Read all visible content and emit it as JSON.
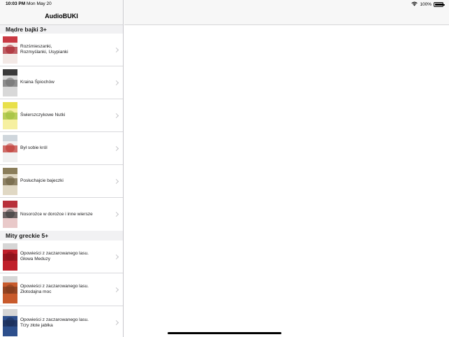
{
  "status_bar": {
    "time": "10:03 PM",
    "date": "Mon May 20",
    "battery": "100%",
    "battery_level": 1.0,
    "wifi_icon": "wifi-icon",
    "battery_icon": "battery-icon"
  },
  "app": {
    "title": "AudioBUKI"
  },
  "sections": [
    {
      "title": "Mądre bajki 3+",
      "items": [
        {
          "label": "Rozśmieszanki,\nRozmyślanki, Usypianki",
          "cover_colors": [
            "#c93a44",
            "#f3e9e6",
            "#a8222c"
          ]
        },
        {
          "label": "Kraina Śpiochów",
          "cover_colors": [
            "#3a3a3a",
            "#d8d8d8",
            "#6f6f6f"
          ]
        },
        {
          "label": "Świerszczykowe Nutki",
          "cover_colors": [
            "#e8e04a",
            "#f6f0a0",
            "#9fbf3a"
          ]
        },
        {
          "label": "Był sobie król",
          "cover_colors": [
            "#cfd6dc",
            "#f1f1f1",
            "#c0342f"
          ]
        },
        {
          "label": "Posłuchajcie bajeczki",
          "cover_colors": [
            "#8a7d5a",
            "#e0d8c4",
            "#6c5f3f"
          ]
        },
        {
          "label": "Nosorożce w dorożce i inne wiersze",
          "cover_colors": [
            "#b8303a",
            "#e9c9c9",
            "#3b3b3b"
          ]
        }
      ]
    },
    {
      "title": "Mity greckie 5+",
      "items": [
        {
          "label": "Opowieści z zaczarowanego lasu.\nGłowa Meduzy",
          "cover_colors": [
            "#d6d6d6",
            "#c0202a",
            "#8a141b"
          ]
        },
        {
          "label": "Opowieści z zaczarowanego lasu.\nZłotodajna moc",
          "cover_colors": [
            "#d6d6d6",
            "#c85a2c",
            "#7d3a1e"
          ]
        },
        {
          "label": "Opowieści z zaczarowanego lasu.\nTrzy złote jabłka",
          "cover_colors": [
            "#d6d6d6",
            "#2d4f8c",
            "#1c2e55"
          ]
        }
      ]
    }
  ]
}
